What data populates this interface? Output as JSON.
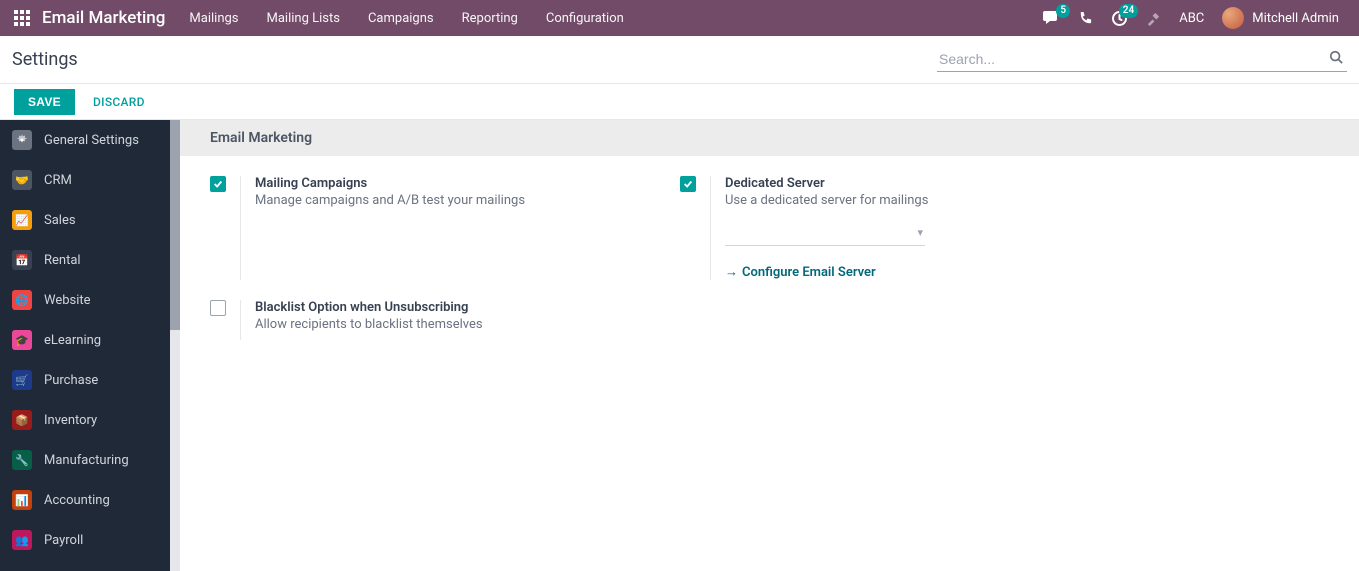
{
  "topbar": {
    "brand": "Email Marketing",
    "menu": [
      "Mailings",
      "Mailing Lists",
      "Campaigns",
      "Reporting",
      "Configuration"
    ],
    "badge_chat": "5",
    "badge_clock": "24",
    "company": "ABC",
    "user": "Mitchell Admin"
  },
  "subheader": {
    "title": "Settings",
    "search_placeholder": "Search..."
  },
  "actions": {
    "save": "SAVE",
    "discard": "DISCARD"
  },
  "sidebar": {
    "items": [
      {
        "label": "General Settings",
        "color": "#6b7280",
        "icon": "gear"
      },
      {
        "label": "CRM",
        "color": "#374151",
        "icon": "handshake"
      },
      {
        "label": "Sales",
        "color": "#f59e0b",
        "icon": "chart"
      },
      {
        "label": "Rental",
        "color": "#374151",
        "icon": "calendar"
      },
      {
        "label": "Website",
        "color": "#ef4444",
        "icon": "globe"
      },
      {
        "label": "eLearning",
        "color": "#ec4899",
        "icon": "book"
      },
      {
        "label": "Purchase",
        "color": "#1e3a8a",
        "icon": "cart"
      },
      {
        "label": "Inventory",
        "color": "#991b1b",
        "icon": "box"
      },
      {
        "label": "Manufacturing",
        "color": "#065f46",
        "icon": "wrench"
      },
      {
        "label": "Accounting",
        "color": "#c2410c",
        "icon": "ledger"
      },
      {
        "label": "Payroll",
        "color": "#be185d",
        "icon": "users"
      }
    ]
  },
  "content": {
    "section_title": "Email Marketing",
    "settings": [
      {
        "title": "Mailing Campaigns",
        "desc": "Manage campaigns and A/B test your mailings",
        "checked": true
      },
      {
        "title": "Dedicated Server",
        "desc": "Use a dedicated server for mailings",
        "checked": true,
        "link": "Configure Email Server",
        "has_dropdown": true
      },
      {
        "title": "Blacklist Option when Unsubscribing",
        "desc": "Allow recipients to blacklist themselves",
        "checked": false
      }
    ]
  }
}
